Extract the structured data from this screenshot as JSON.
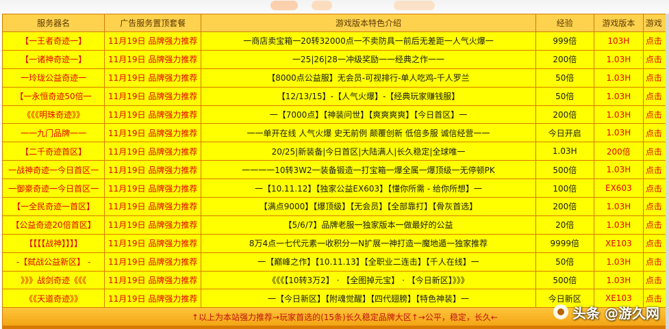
{
  "colors": {
    "frame": "#d67a00",
    "header_bg": "#ffd24d",
    "row_bg": "#ffff00",
    "red_text": "#e00000",
    "footer_text": "#c01010"
  },
  "table": {
    "headers": [
      "服务器名",
      "广告服务置顶套餐",
      "游戏版本特色介绍",
      "经验",
      "游戏版本",
      "游戏"
    ],
    "rows": [
      {
        "server": "【一王者奇迹一】",
        "time": "11月19日 品牌强力推荐",
        "intro": "一商店卖宝箱一20转32000点一不卖防具一前后无差距一人气火爆一",
        "exp": "999倍",
        "version": "103H",
        "action": "点击"
      },
      {
        "server": "【一诸神奇迹一】",
        "time": "11月19日 品牌强力推荐",
        "intro": "一25|26|28一冲级奖励一一经典之作一一",
        "exp": "200倍",
        "version": "1.03H",
        "action": "点击"
      },
      {
        "server": "一玲珑公益奇迹一",
        "time": "11月19日 品牌强力推荐",
        "intro": "【8000点公益服】无会员-可视排行-单人吃鸡-千人罗兰",
        "exp": "50倍",
        "version": "1.03H",
        "action": "点击"
      },
      {
        "server": "【一永恒奇迹50倍一",
        "time": "11月19日 品牌强力推荐",
        "intro": "【12/13/15】-【人气火爆】-【经典玩家赚钱服】",
        "exp": "50倍",
        "version": "1.03H",
        "action": "点击"
      },
      {
        "server": "《《《明珠奇迹》》",
        "time": "11月19日 品牌强力推荐",
        "intro": "一【7000点】【神装问世】【爽爽爽爽】【今日首区】一",
        "exp": "200倍",
        "version": "1.03H",
        "action": "点击"
      },
      {
        "server": "一一九门品牌一一",
        "time": "11月19日 品牌强力推荐",
        "intro": "一一单开在线 人气火爆 史无前例 颠覆创新 低倍多服 诚信经营一一",
        "exp": "今日开启",
        "version": "1.03H",
        "action": "点击"
      },
      {
        "server": "【二千奇迹首区】",
        "time": "11月19日 品牌强力推荐",
        "intro": "20/25|新装备|今日首区|大陆满人|长久稳定|全球唯一",
        "exp": "1.03H",
        "version": "200倍",
        "action": "点击"
      },
      {
        "server": "一战神奇迹一今日首区一",
        "time": "11月19日 品牌强力推荐",
        "intro": "一一一一10转3W2一装备锻造一打宝箱一爆全属一爆顶级一无停顿PK",
        "exp": "500倍",
        "version": "1.03H",
        "action": "点击"
      },
      {
        "server": "一御豪奇迹一今日首区一",
        "time": "11月19日 品牌强力推荐",
        "intro": "一【10.11.12】【独家公益EX603】【懂你所需 - 给你所想】一",
        "exp": "100倍",
        "version": "EX603",
        "action": "点击"
      },
      {
        "server": "【一全民奇迹一首区】",
        "time": "11月19日 品牌强力推荐",
        "intro": "【满点9000】【爆顶级】【无会员】【全部靠打】【骨灰首选】",
        "exp": "200倍",
        "version": "1.03H",
        "action": "点击"
      },
      {
        "server": "【公益奇迹20倍首区】",
        "time": "11月19日 品牌强力推荐",
        "intro": "【5/6/7】品牌老服一独家版本一做最好的公益",
        "exp": "20倍",
        "version": "1.03H",
        "action": "点击"
      },
      {
        "server": "【【【【战神】】】】",
        "time": "11月19日 品牌强力推荐",
        "intro": "8万4点一七代元素一收积分一N扩展一神打造一魔地遁一独家推荐",
        "exp": "9999倍",
        "version": "XE103",
        "action": "点击"
      },
      {
        "server": "-【弑战公益新区】 -",
        "time": "11月19日 品牌强力推荐",
        "intro": "一【巅峰之作】【10.11.13】【全职业二连击】【千人在线】一",
        "exp": "50倍",
        "version": "1.03H",
        "action": "点击"
      },
      {
        "server": "》》》战剑奇迹《《《",
        "time": "11月19日 品牌强力推荐",
        "intro": "《《《【10转3万2】 · 【全图掉元宝】 · 【今日新区】》》》",
        "exp": "500倍",
        "version": "1.03H",
        "action": "点击"
      },
      {
        "server": "《《天道奇迹》》",
        "time": "11月19日 品牌强力推荐",
        "intro": "一【今日新区】【附魂觉醒】【四代翅膀】【特色神装】一",
        "exp": "今日新区",
        "version": "XE103",
        "action": "点击"
      }
    ],
    "footer": "↑以上为本站强力推荐→玩家首选的(15条)长久稳定品牌大区↑→公平，稳定，长久←"
  },
  "watermark": {
    "text": "头条 @游久网"
  }
}
